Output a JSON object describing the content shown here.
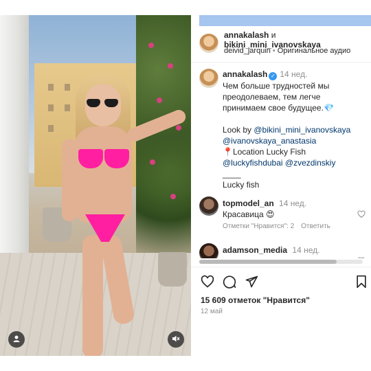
{
  "header": {
    "user1": "annakalash",
    "and": "и",
    "user2": "bikini_mini_ivanovskaya",
    "audio_user": "deivid_jarquin",
    "audio_label": "Оригинальное аудио"
  },
  "caption": {
    "username": "annakalash",
    "time": "14 нед.",
    "line1": "Чем больше трудностей мы",
    "line2": "преодолеваем, тем легче",
    "line3": "принимаем свое будущее.",
    "gem": "💎",
    "look_by": "Look by",
    "mention1": "@bikini_mini_ivanovskaya",
    "mention2": "@ivanovskaya_anastasia",
    "pin": "📍",
    "location": "Location Lucky Fish",
    "mention3": "@luckyfishdubai",
    "mention4": "@zvezdinskiy",
    "rule": "____",
    "footer": "Lucky fish"
  },
  "comments": [
    {
      "username": "topmodel_an",
      "time": "14 нед.",
      "text": "Красавица",
      "emoji": "😍",
      "likes_label": "Отметки \"Нравится\": 2",
      "reply_label": "Ответить"
    },
    {
      "username": "adamson_media",
      "time": "14 нед."
    }
  ],
  "post": {
    "likes": "15 609 отметок \"Нравится\"",
    "date": "12 май"
  },
  "icons": {
    "like": "heart-icon",
    "comment": "comment-icon",
    "share": "send-icon",
    "save": "bookmark-icon",
    "user_tag": "user-icon",
    "mute": "mute-icon"
  },
  "colors": {
    "link": "#00376b",
    "verified": "#3897f0",
    "accent_bar": "#a6c5ef"
  }
}
